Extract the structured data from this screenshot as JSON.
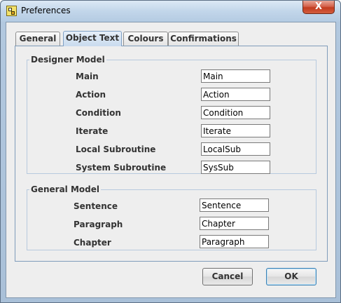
{
  "window": {
    "title": "Preferences",
    "close_label": "X",
    "icon": "preferences-app-icon"
  },
  "tabs": [
    {
      "label": "General",
      "active": false
    },
    {
      "label": "Object Text",
      "active": true
    },
    {
      "label": "Colours",
      "active": false
    },
    {
      "label": "Confirmations",
      "active": false
    }
  ],
  "designer_model": {
    "legend": "Designer Model",
    "rows": [
      {
        "label": "Main",
        "value": "Main"
      },
      {
        "label": "Action",
        "value": "Action"
      },
      {
        "label": "Condition",
        "value": "Condition"
      },
      {
        "label": "Iterate",
        "value": "Iterate"
      },
      {
        "label": "Local Subroutine",
        "value": "LocalSub"
      },
      {
        "label": "System Subroutine",
        "value": "SysSub"
      }
    ]
  },
  "general_model": {
    "legend": "General Model",
    "rows": [
      {
        "label": "Sentence",
        "value": "Sentence"
      },
      {
        "label": "Paragraph",
        "value": "Chapter"
      },
      {
        "label": "Chapter",
        "value": "Paragraph"
      }
    ]
  },
  "buttons": {
    "cancel": "Cancel",
    "ok": "OK"
  }
}
